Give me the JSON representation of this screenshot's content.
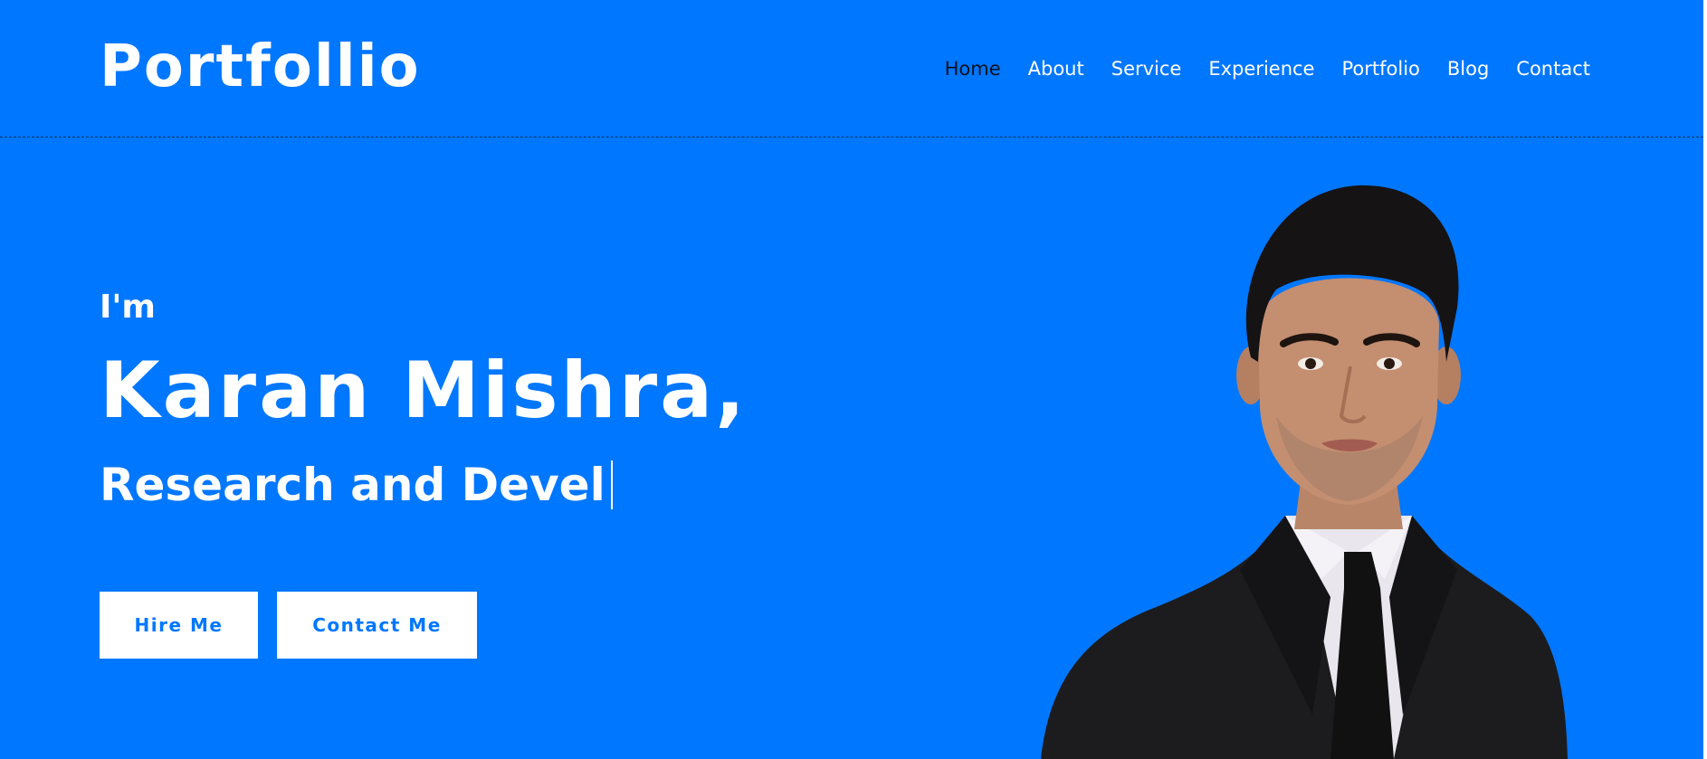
{
  "header": {
    "logo": "Portfollio",
    "nav": [
      {
        "label": "Home",
        "active": true
      },
      {
        "label": "About"
      },
      {
        "label": "Service"
      },
      {
        "label": "Experience"
      },
      {
        "label": "Portfolio"
      },
      {
        "label": "Blog"
      },
      {
        "label": "Contact"
      }
    ]
  },
  "hero": {
    "intro": "I'm",
    "name": "Karan Mishra,",
    "role_typed": "Research and Devel",
    "buttons": {
      "hire": "Hire Me",
      "contact": "Contact Me"
    }
  },
  "colors": {
    "background": "#0077ff",
    "text": "#ffffff",
    "active_nav": "#0b1220",
    "button_bg": "#ffffff",
    "button_text": "#0077ff"
  }
}
